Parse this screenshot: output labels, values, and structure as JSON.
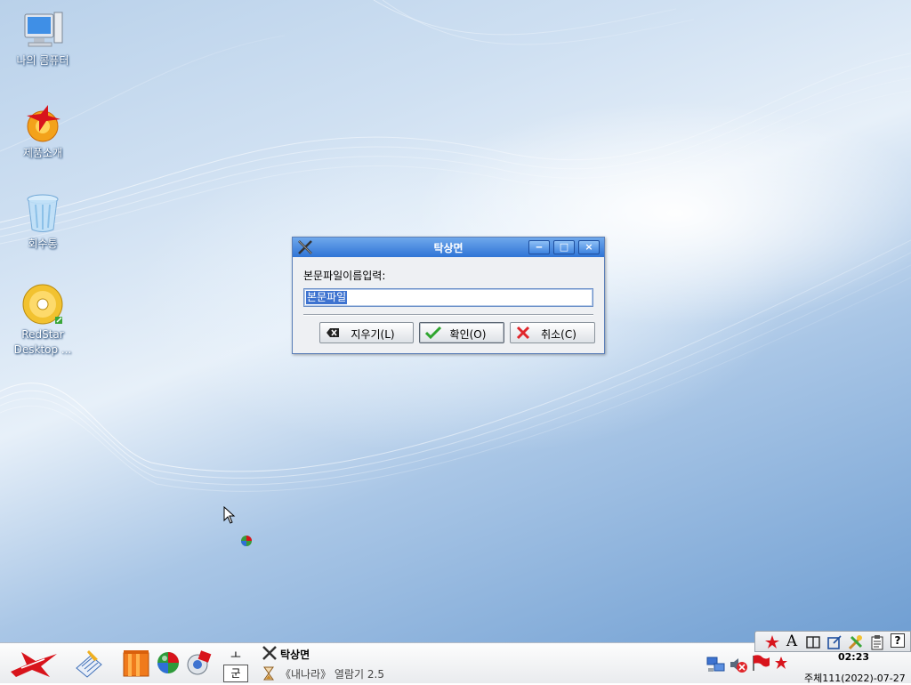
{
  "desktop": {
    "icons": [
      {
        "label": "나의 콤퓨터"
      },
      {
        "label": "제품소개"
      },
      {
        "label": "회수통"
      },
      {
        "label": "RedStar Desktop ..."
      }
    ]
  },
  "dialog": {
    "title": "탁상면",
    "prompt": "본문파일이름입력:",
    "filename_value": "본문파일",
    "buttons": {
      "clear": "지우기(L)",
      "ok": "확인(O)",
      "cancel": "취소(C)"
    },
    "window_controls": {
      "minimize": "‒",
      "maximize": "□",
      "close": "×"
    }
  },
  "taskbar": {
    "pager": {
      "top": "ㅗ",
      "bottom": "군"
    },
    "tasks": [
      {
        "label": "탁상면",
        "active": true
      },
      {
        "label": "《내나라》 열람기 2.5",
        "active": false
      }
    ],
    "tray": {
      "font_glyph": "A",
      "help_glyph": "?"
    },
    "clock_time": "02:23",
    "clock_date": "주체111(2022)-07-27"
  },
  "colors": {
    "titlebar": "#2f74d6",
    "accent_red": "#d8141c",
    "selection": "#3e73d0"
  }
}
